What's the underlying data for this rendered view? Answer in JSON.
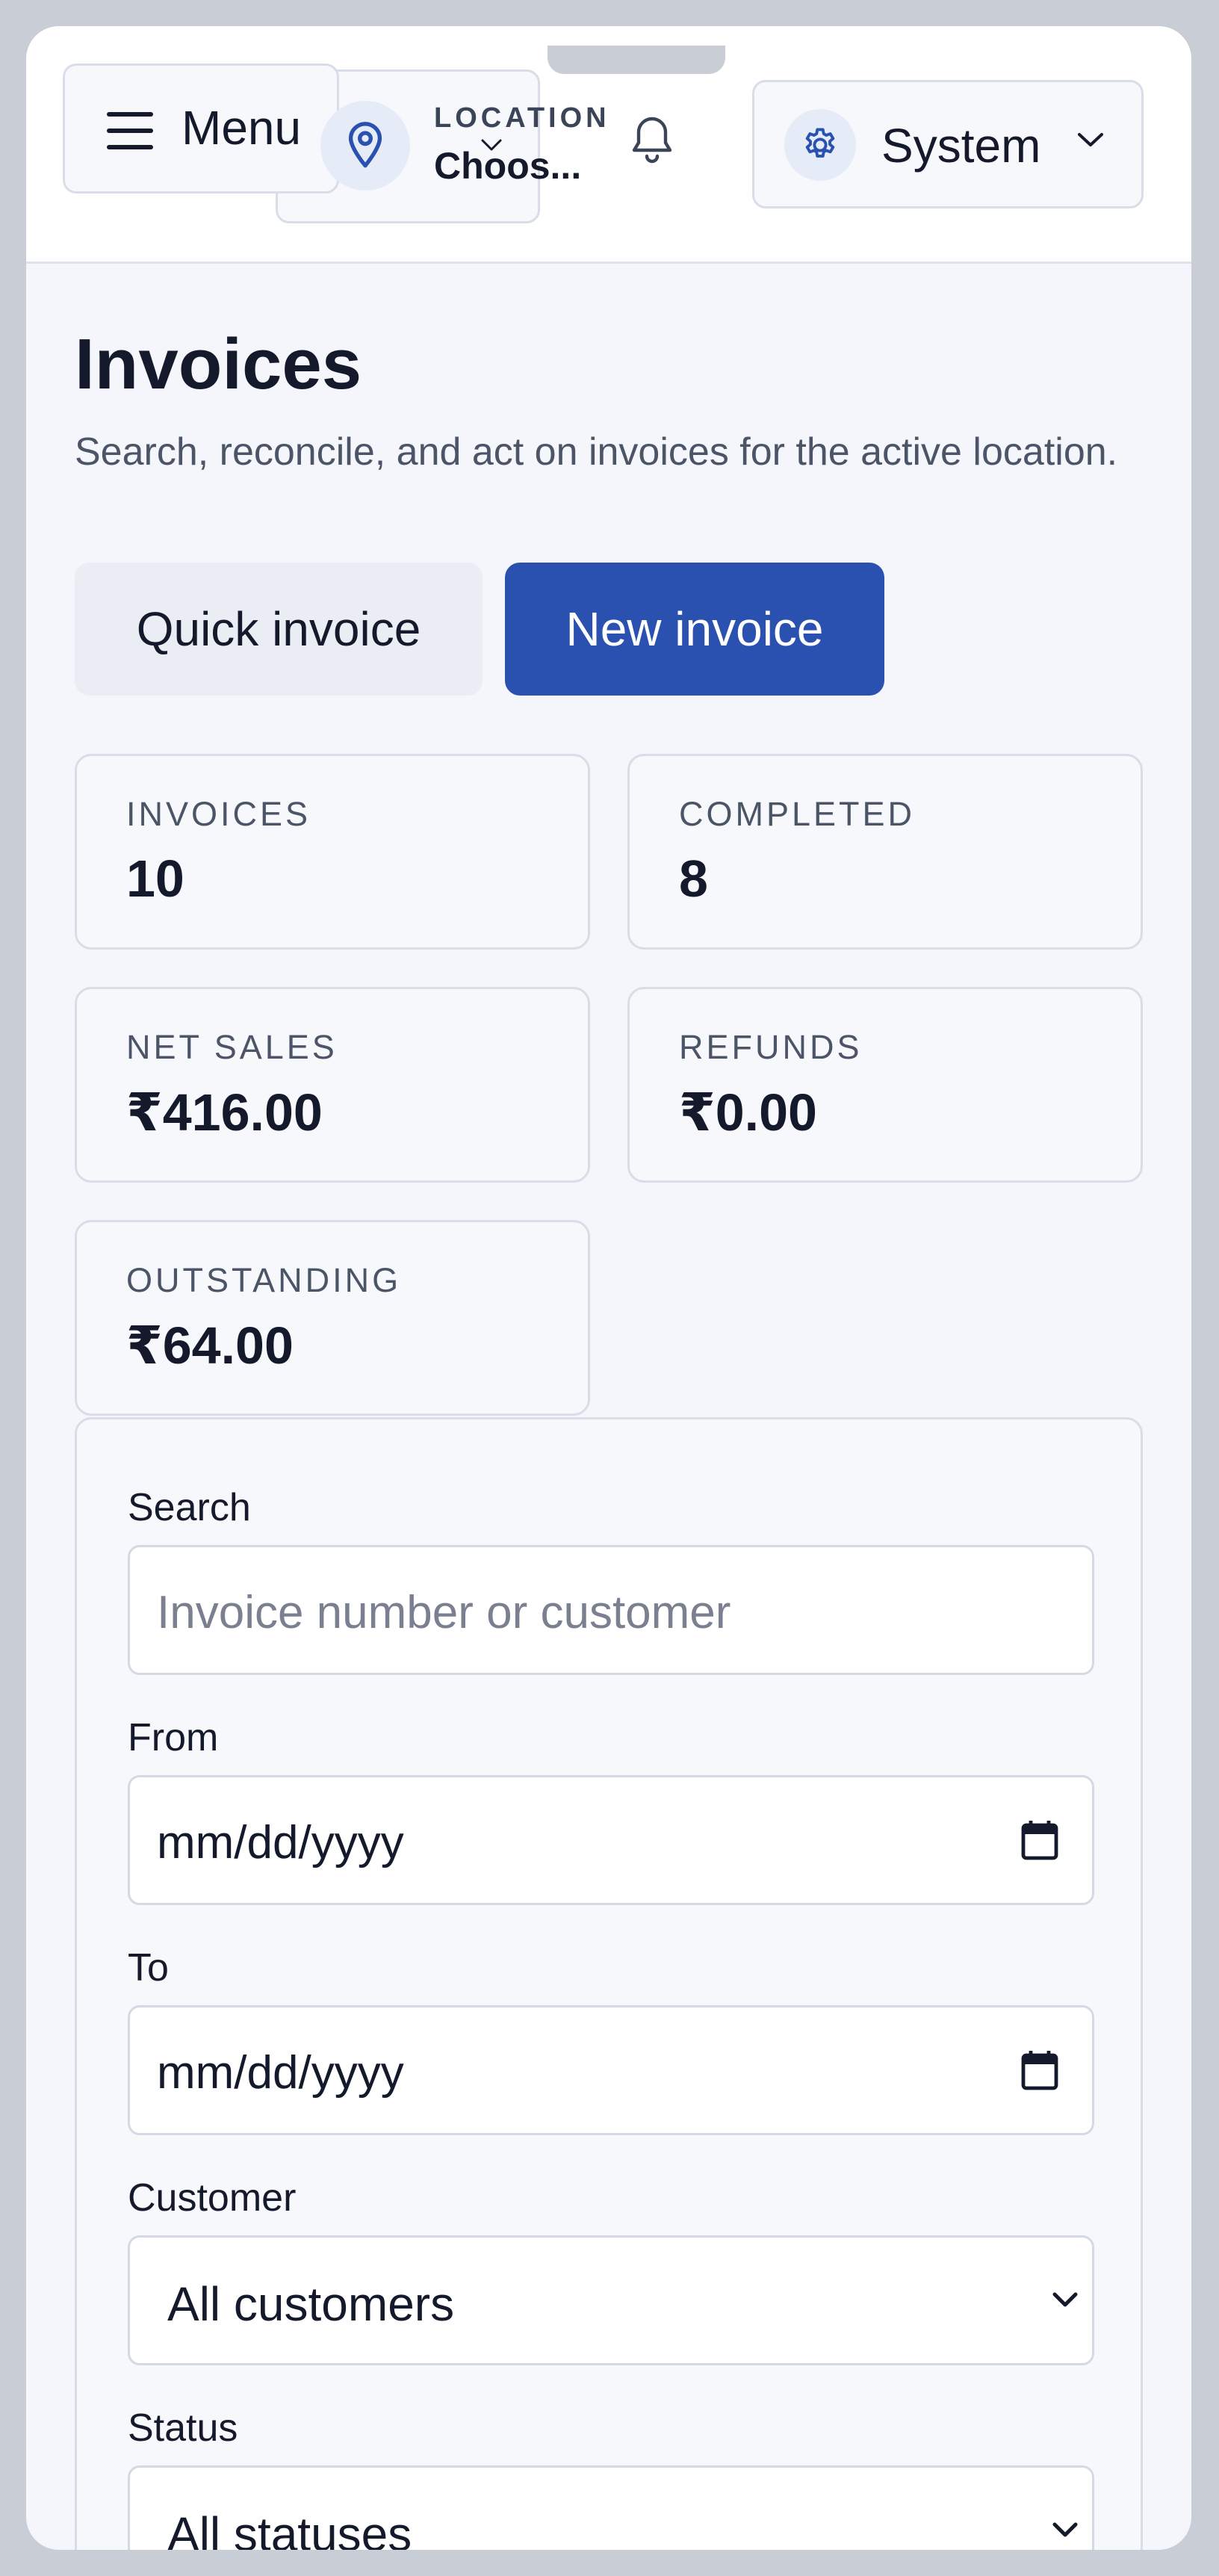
{
  "header": {
    "menu_label": "Menu",
    "location_caption": "LOCATION",
    "location_value": "Choos...",
    "system_label": "System",
    "icons": [
      "hamburger-icon",
      "location-pin-icon",
      "chevron-down-icon",
      "bell-icon",
      "gear-icon"
    ]
  },
  "page": {
    "title": "Invoices",
    "subtitle": "Search, reconcile, and act on invoices for the active location."
  },
  "actions": {
    "quick_invoice": "Quick invoice",
    "new_invoice": "New invoice"
  },
  "stats": [
    {
      "label": "INVOICES",
      "value": "10"
    },
    {
      "label": "COMPLETED",
      "value": "8"
    },
    {
      "label": "NET SALES",
      "value": "₹416.00"
    },
    {
      "label": "REFUNDS",
      "value": "₹0.00"
    },
    {
      "label": "OUTSTANDING",
      "value": "₹64.00"
    }
  ],
  "filters": {
    "search": {
      "label": "Search",
      "placeholder": "Invoice number or customer"
    },
    "from": {
      "label": "From",
      "value": "mm/dd/yyyy"
    },
    "to": {
      "label": "To",
      "value": "mm/dd/yyyy"
    },
    "customer": {
      "label": "Customer",
      "selected": "All customers"
    },
    "status": {
      "label": "Status",
      "selected": "All statuses"
    }
  },
  "colors": {
    "primary": "#2a50b0",
    "text": "#141a2b",
    "muted": "#4c5567",
    "border": "#d8dde8",
    "background": "#f4f6fb"
  }
}
